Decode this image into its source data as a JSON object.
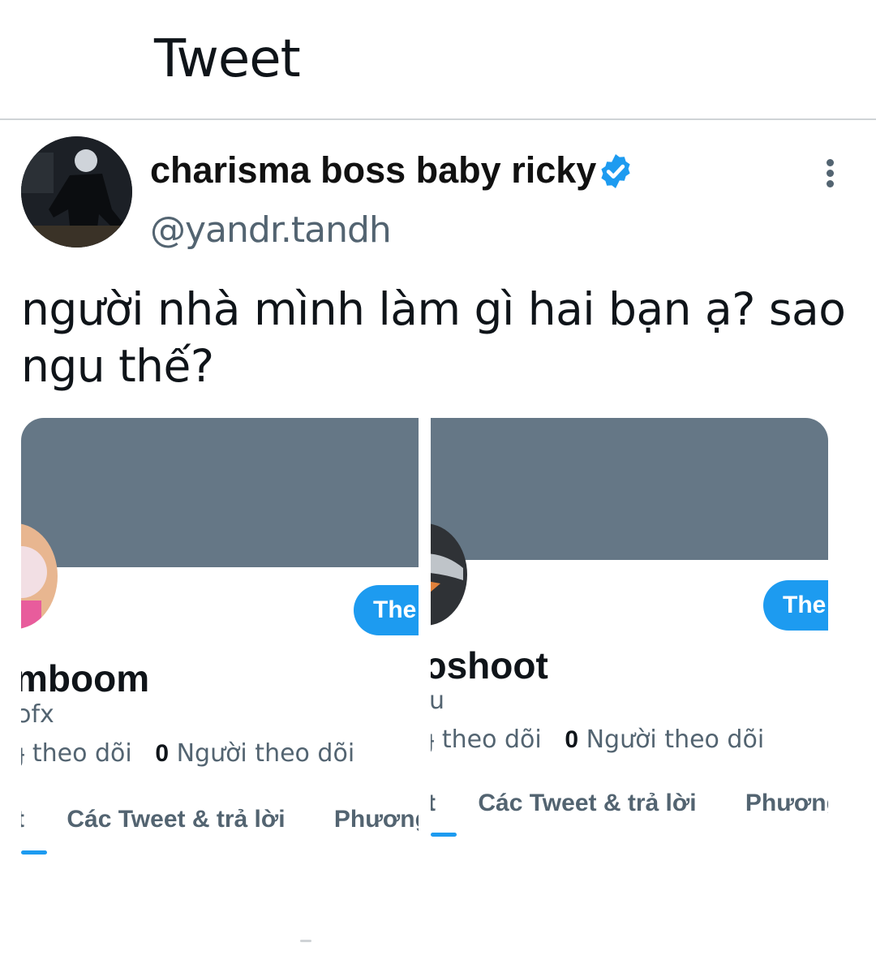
{
  "header": {
    "title": "Tweet"
  },
  "author": {
    "display_name": "charisma boss baby ricky",
    "handle": "@yandr.tandh",
    "verified": true
  },
  "tweet": {
    "text": "người nhà mình làm gì hai bạn ạ? sao ngu thế?"
  },
  "colors": {
    "accent": "#1d9bf0",
    "banner": "#657786",
    "secondary_text": "#536471"
  },
  "screenshots": [
    {
      "name_partial": "mboom",
      "handle_partial": "ɔfx",
      "follow_label": "The",
      "stats": {
        "following_partial": "ɟ theo dõi",
        "followers_count": "0",
        "followers_label": "Người theo dõi"
      },
      "tabs": {
        "first_partial": "t",
        "second": "Các Tweet & trả lời",
        "third_partial": "Phương"
      }
    },
    {
      "name_partial": "ɔshoot",
      "handle_partial": "u",
      "follow_label": "The",
      "stats": {
        "following_partial": "ɟ theo dõi",
        "followers_count": "0",
        "followers_label": "Người theo dõi"
      },
      "tabs": {
        "first_partial": "t",
        "second": "Các Tweet & trả lời",
        "third_partial": "Phương"
      }
    }
  ]
}
